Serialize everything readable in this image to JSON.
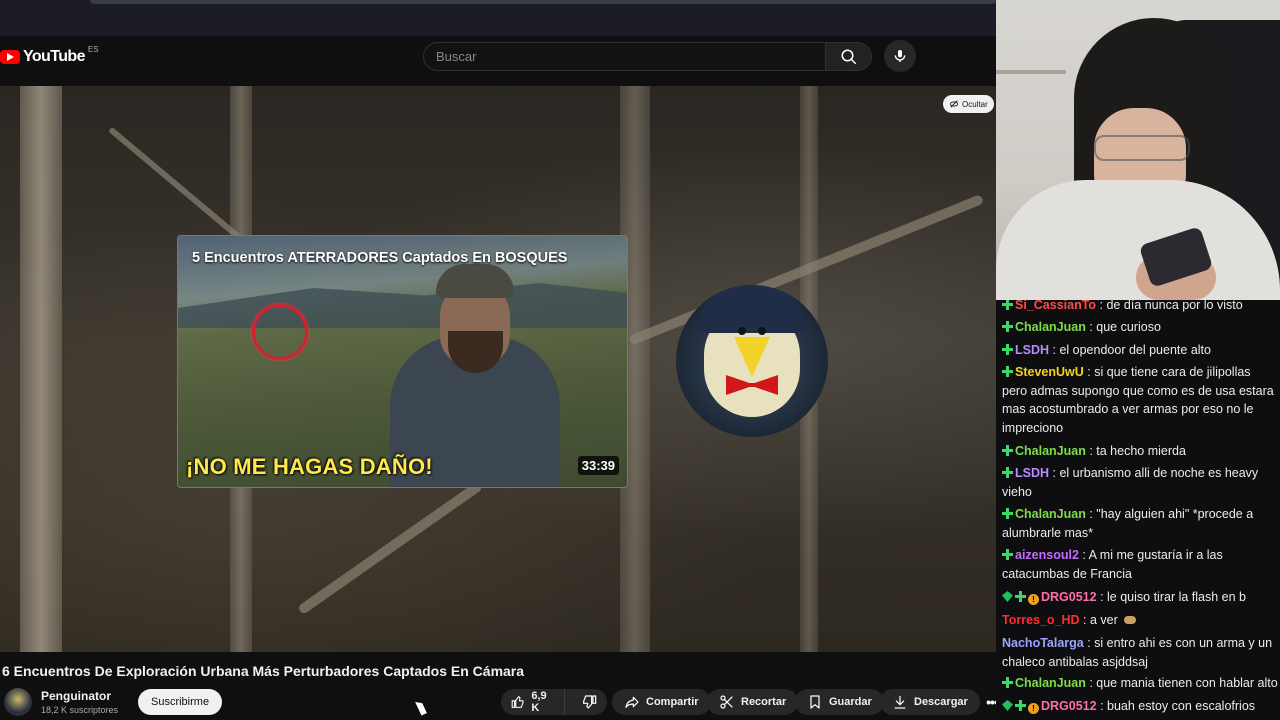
{
  "youtube": {
    "logo_text": "YouTube",
    "region": "ES",
    "search_placeholder": "Buscar"
  },
  "player": {
    "hide_label": "Ocultar",
    "overlay": {
      "title": "5 Encuentros ATERRADORES Captados En BOSQUES",
      "quote": "¡NO ME HAGAS DAÑO!",
      "duration": "33:39"
    }
  },
  "video": {
    "title": "6 Encuentros De Exploración Urbana Más Perturbadores Captados En Cámara",
    "channel_name": "Penguinator",
    "subscribers": "18,2 K suscriptores",
    "subscribe_label": "Suscribirme",
    "likes": "6,9 K",
    "share_label": "Compartir",
    "clip_label": "Recortar",
    "save_label": "Guardar",
    "download_label": "Descargar"
  },
  "chat": {
    "messages": [
      {
        "user": "Si_CassianTo",
        "color": "#ff4a4a",
        "badges": [
          "plus"
        ],
        "text": "de día nunca por lo visto"
      },
      {
        "user": "ChalanJuan",
        "color": "#7ddc4a",
        "badges": [
          "plus"
        ],
        "text": "que curioso"
      },
      {
        "user": "LSDH",
        "color": "#b88cff",
        "badges": [
          "plus"
        ],
        "text": "el opendoor del puente alto"
      },
      {
        "user": "StevenUwU",
        "color": "#f6d31d",
        "badges": [
          "plus"
        ],
        "text": "si que tiene cara de jilipollas pero admas supongo que como es de usa estara mas acostumbrado a ver armas por eso no le impreciono"
      },
      {
        "user": "ChalanJuan",
        "color": "#7ddc4a",
        "badges": [
          "plus"
        ],
        "text": "ta hecho mierda"
      },
      {
        "user": "LSDH",
        "color": "#b88cff",
        "badges": [
          "plus"
        ],
        "text": "el urbanismo alli de noche es heavy vieho"
      },
      {
        "user": "ChalanJuan",
        "color": "#7ddc4a",
        "badges": [
          "plus"
        ],
        "text": "\"hay alguien ahi\" *procede a alumbrarle mas*"
      },
      {
        "user": "aizensoul2",
        "color": "#c26bff",
        "badges": [
          "plus"
        ],
        "text": "A mi me gustaría ir a las catacumbas de Francia"
      },
      {
        "user": "DRG0512",
        "color": "#ff6ea8",
        "badges": [
          "gem",
          "plus",
          "warn"
        ],
        "text": "le quiso tirar la flash en b"
      },
      {
        "user": "Torres_o_HD",
        "color": "#ff2e2e",
        "badges": [],
        "text": "a ver"
      },
      {
        "user": "NachoTalarga",
        "color": "#9aa5ff",
        "badges": [],
        "text": "si entro ahi es con un arma y un chaleco antibalas asjddsaj"
      },
      {
        "user": "ChalanJuan",
        "color": "#7ddc4a",
        "badges": [
          "plus"
        ],
        "text": "que mania tienen con hablar alto"
      },
      {
        "user": "DRG0512",
        "color": "#ff6ea8",
        "badges": [
          "gem",
          "plus",
          "warn"
        ],
        "text": "buah estoy con escalofrios"
      }
    ]
  },
  "colors": {
    "accent_red": "#ff0000",
    "overlay_quote": "#ffe94a",
    "background": "#0f0f0f"
  }
}
